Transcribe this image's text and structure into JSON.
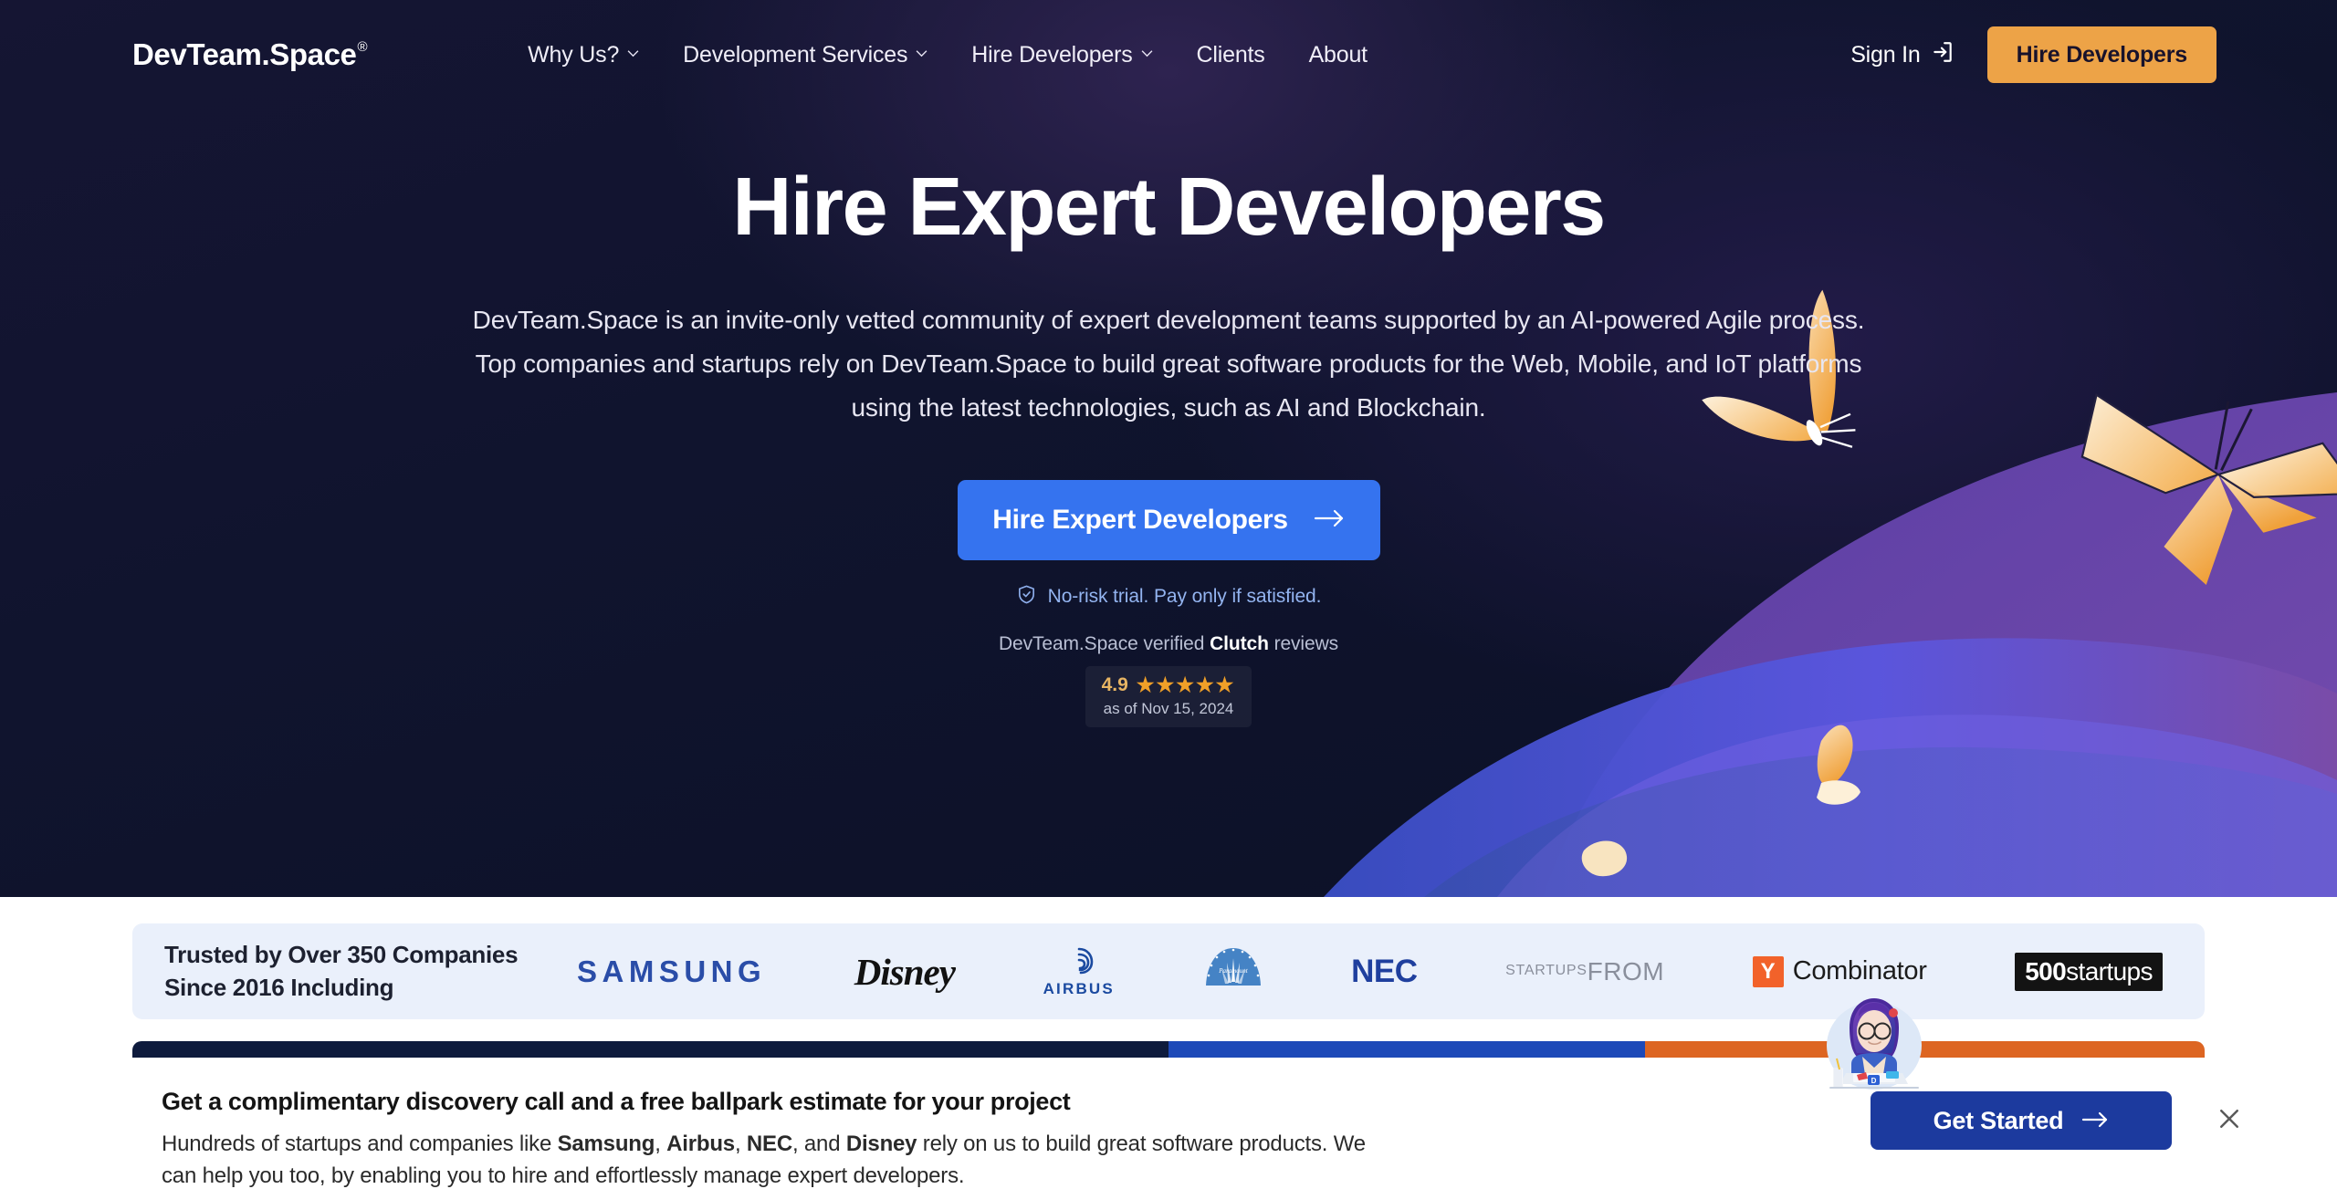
{
  "header": {
    "logo": "DevTeam.Space",
    "logo_mark": "®",
    "nav": [
      {
        "label": "Why Us?",
        "caret": true,
        "icon": "chevron-down-icon"
      },
      {
        "label": "Development Services",
        "caret": true,
        "icon": "chevron-down-icon"
      },
      {
        "label": "Hire Developers",
        "caret": true,
        "icon": "chevron-down-icon"
      },
      {
        "label": "Clients",
        "caret": false
      },
      {
        "label": "About",
        "caret": false
      }
    ],
    "sign_in": "Sign In",
    "sign_in_icon": "login-arrow-icon",
    "hire_button": "Hire Developers"
  },
  "hero": {
    "title": "Hire Expert Developers",
    "subtitle": "DevTeam.Space is an invite-only vetted community of expert development teams supported by an AI-powered Agile process. Top companies and startups rely on DevTeam.Space to build great software products for the Web, Mobile, and IoT platforms using the latest technologies, such as AI and Blockchain.",
    "cta_label": "Hire Expert Developers",
    "cta_icon": "arrow-right-icon",
    "no_risk": "No-risk trial. Pay only if satisfied.",
    "no_risk_icon": "shield-check-icon",
    "clutch_prefix": "DevTeam.Space verified ",
    "clutch_brand": "Clutch",
    "clutch_suffix": " reviews",
    "rating_value": "4.9",
    "rating_stars": "★★★★★",
    "rating_date": "as of Nov 15, 2024",
    "colors": {
      "cta_blue": "#3573ef",
      "accent_orange": "#eda347",
      "star_orange": "#f0a028",
      "hero_bg": "#10142e"
    }
  },
  "trusted": {
    "headline_line1": "Trusted by Over 350 Companies",
    "headline_line2": "Since 2016 Including",
    "logos": [
      {
        "name": "samsung-logo",
        "text": "SAMSUNG"
      },
      {
        "name": "disney-logo",
        "text": "Disney"
      },
      {
        "name": "airbus-logo",
        "text": "AIRBUS"
      },
      {
        "name": "paramount-logo",
        "text": "Paramount"
      },
      {
        "name": "nec-logo",
        "text": "NEC"
      },
      {
        "name": "startups-from-logo",
        "text1": "STARTUPS",
        "text2": "FROM"
      },
      {
        "name": "y-combinator-logo",
        "mark": "Y",
        "text": "Combinator"
      },
      {
        "name": "500startups-logo",
        "bold": "500",
        "thin": "startups"
      }
    ]
  },
  "banner": {
    "heading": "Get a complimentary discovery call and a free ballpark estimate for your project",
    "body_1": "Hundreds of startups and companies like ",
    "b_samsung": "Samsung",
    "body_2": ", ",
    "b_airbus": "Airbus",
    "body_3": ", ",
    "b_nec": "NEC",
    "body_4": ", and ",
    "b_disney": "Disney",
    "body_5": " rely on us to build great software products. We can help you too, by enabling you to hire and effortlessly manage expert developers.",
    "cta_label": "Get Started",
    "cta_icon": "arrow-right-icon",
    "close_icon": "close-icon",
    "avatar_icon": "developer-avatar-illustration",
    "bar_colors": {
      "navy": "#0e1b3d",
      "blue": "#1d49b8",
      "orange": "#dd6522"
    },
    "cta_color": "#1c3a9e"
  }
}
